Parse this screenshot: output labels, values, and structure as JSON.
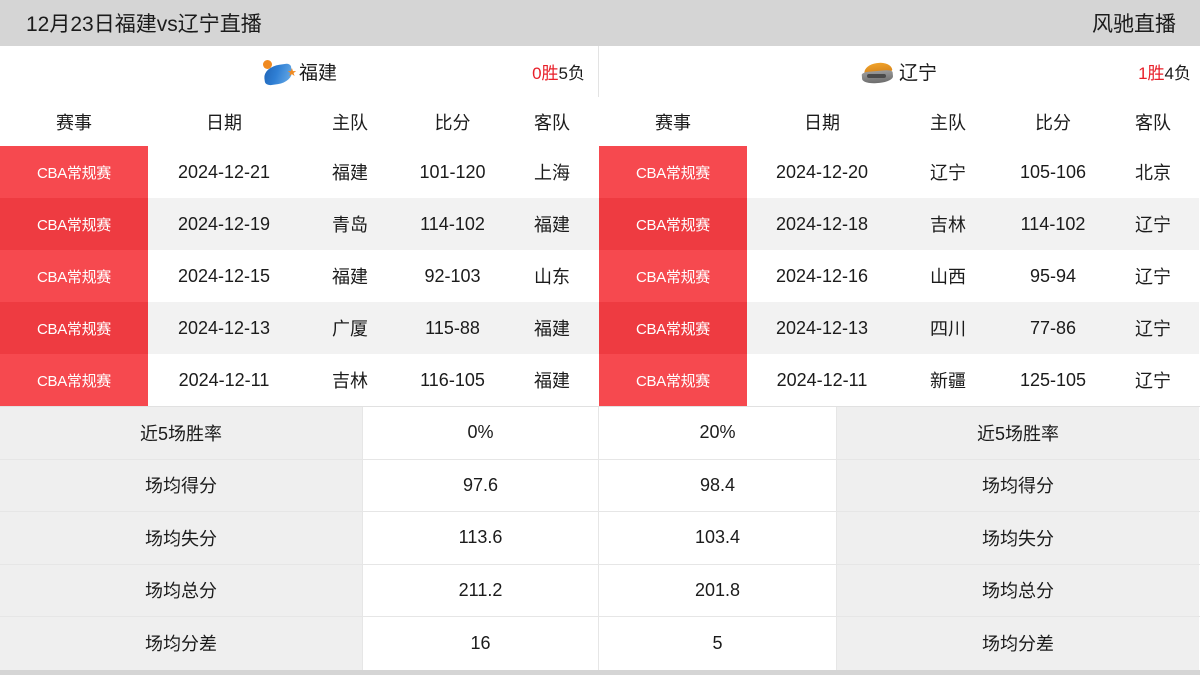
{
  "topbar": {
    "title": "12月23日福建vs辽宁直播",
    "brand": "风驰直播"
  },
  "left_panel": {
    "team_name": "福建",
    "logo_icon": "fujian-sturgeons-logo-icon",
    "record_win": "0胜",
    "record_loss": "5负",
    "columns": [
      "赛事",
      "日期",
      "主队",
      "比分",
      "客队"
    ],
    "rows": [
      {
        "league": "CBA常规赛",
        "date": "2024-12-21",
        "home": "福建",
        "score": "101-120",
        "away": "上海"
      },
      {
        "league": "CBA常规赛",
        "date": "2024-12-19",
        "home": "青岛",
        "score": "114-102",
        "away": "福建"
      },
      {
        "league": "CBA常规赛",
        "date": "2024-12-15",
        "home": "福建",
        "score": "92-103",
        "away": "山东"
      },
      {
        "league": "CBA常规赛",
        "date": "2024-12-13",
        "home": "广厦",
        "score": "115-88",
        "away": "福建"
      },
      {
        "league": "CBA常规赛",
        "date": "2024-12-11",
        "home": "吉林",
        "score": "116-105",
        "away": "福建"
      }
    ]
  },
  "right_panel": {
    "team_name": "辽宁",
    "logo_icon": "liaoning-flying-leopards-logo-icon",
    "record_win": "1胜",
    "record_loss": "4负",
    "columns": [
      "赛事",
      "日期",
      "主队",
      "比分",
      "客队"
    ],
    "rows": [
      {
        "league": "CBA常规赛",
        "date": "2024-12-20",
        "home": "辽宁",
        "score": "105-106",
        "away": "北京"
      },
      {
        "league": "CBA常规赛",
        "date": "2024-12-18",
        "home": "吉林",
        "score": "114-102",
        "away": "辽宁"
      },
      {
        "league": "CBA常规赛",
        "date": "2024-12-16",
        "home": "山西",
        "score": "95-94",
        "away": "辽宁"
      },
      {
        "league": "CBA常规赛",
        "date": "2024-12-13",
        "home": "四川",
        "score": "77-86",
        "away": "辽宁"
      },
      {
        "league": "CBA常规赛",
        "date": "2024-12-11",
        "home": "新疆",
        "score": "125-105",
        "away": "辽宁"
      }
    ]
  },
  "stats": [
    {
      "label_left": "近5场胜率",
      "value_left": "0%",
      "value_right": "20%",
      "label_right": "近5场胜率"
    },
    {
      "label_left": "场均得分",
      "value_left": "97.6",
      "value_right": "98.4",
      "label_right": "场均得分"
    },
    {
      "label_left": "场均失分",
      "value_left": "113.6",
      "value_right": "103.4",
      "label_right": "场均失分"
    },
    {
      "label_left": "场均总分",
      "value_left": "211.2",
      "value_right": "201.8",
      "label_right": "场均总分"
    },
    {
      "label_left": "场均分差",
      "value_left": "16",
      "value_right": "5",
      "label_right": "场均分差"
    }
  ],
  "colors": {
    "league_badge": "#f6494f",
    "league_badge_alt": "#ee3b41",
    "record_win": "#e8202a",
    "page_bg": "#d5d5d5",
    "stat_label_bg": "#efefef",
    "row_alt_bg": "#f2f2f2"
  }
}
